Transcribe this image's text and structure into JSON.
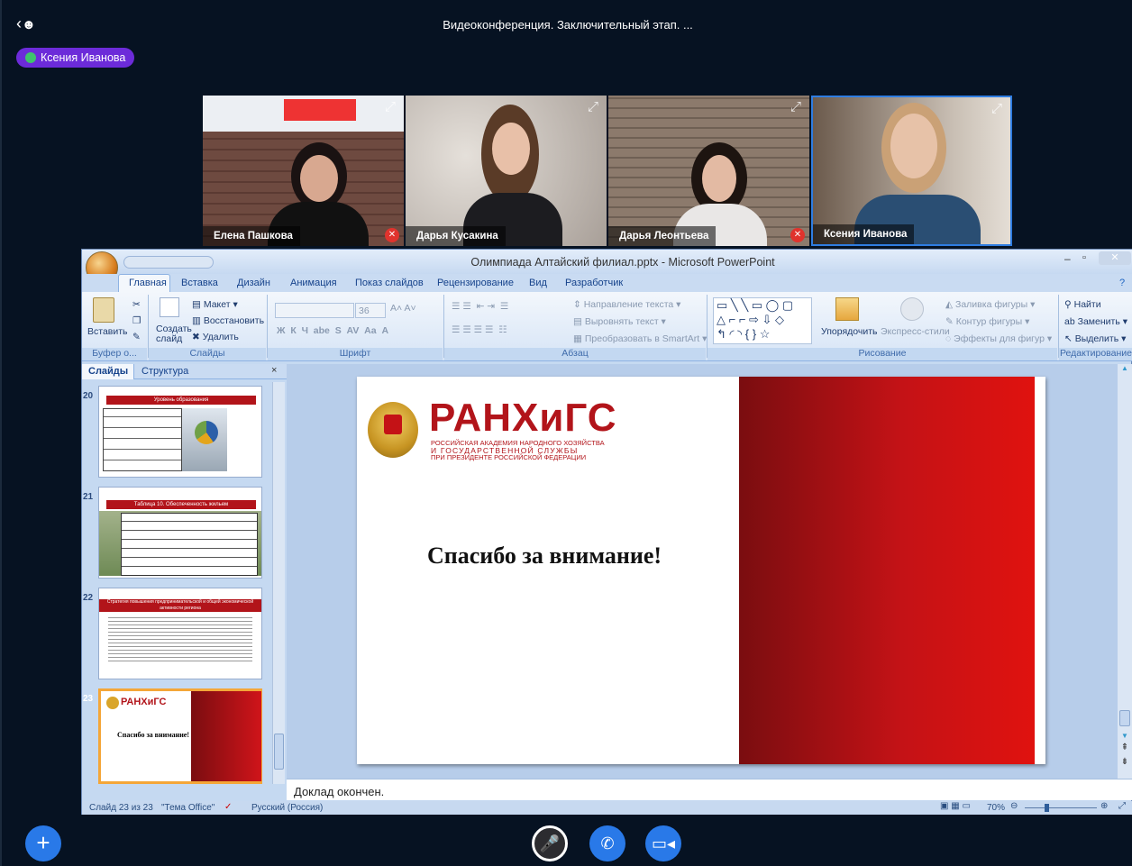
{
  "conference": {
    "title": "Видеоконференция. Заключительный этап. ...",
    "active_speaker": "Ксения Иванова"
  },
  "participants": [
    {
      "name": "Елена Пашкова",
      "muted": true
    },
    {
      "name": "Дарья Кусакина",
      "muted": false
    },
    {
      "name": "Дарья Леонтьева",
      "muted": true
    },
    {
      "name": "Ксения Иванова",
      "muted": false
    }
  ],
  "ppt": {
    "window_title": "Олимпиада Алтайский филиал.pptx - Microsoft PowerPoint",
    "tabs": [
      "Главная",
      "Вставка",
      "Дизайн",
      "Анимация",
      "Показ слайдов",
      "Рецензирование",
      "Вид",
      "Разработчик"
    ],
    "ribbon": {
      "paste": "Вставить",
      "new_slide": "Создать слайд",
      "layout": "Макет",
      "reset": "Восстановить",
      "delete": "Удалить",
      "font_size": "36",
      "text_direction": "Направление текста",
      "align_text": "Выровнять текст",
      "smartart": "Преобразовать в SmartArt",
      "arrange": "Упорядочить",
      "quick_styles": "Экспресс-стили",
      "shape_fill": "Заливка фигуры",
      "shape_outline": "Контур фигуры",
      "shape_effects": "Эффекты для фигур",
      "find": "Найти",
      "replace": "Заменить",
      "select": "Выделить",
      "groups": {
        "clipboard": "Буфер о...",
        "slides": "Слайды",
        "font": "Шрифт",
        "paragraph": "Абзац",
        "drawing": "Рисование",
        "editing": "Редактирование"
      }
    },
    "panel_tabs": [
      "Слайды",
      "Структура"
    ],
    "thumbnails": [
      {
        "num": "20",
        "title": "Уровень образования"
      },
      {
        "num": "21",
        "title": "Таблица 10. Обеспеченность жильем"
      },
      {
        "num": "22",
        "title": "Стратегия повышения предпринимательской и общей экономической активности региона"
      },
      {
        "num": "23",
        "title": "Спасибо за внимание!"
      }
    ],
    "slide": {
      "logo_main": "РАНХиГС",
      "logo_sub1": "РОССИЙСКАЯ АКАДЕМИЯ НАРОДНОГО ХОЗЯЙСТВА",
      "logo_sub2": "И ГОСУДАРСТВЕННОЙ СЛУЖБЫ",
      "logo_sub3": "ПРИ ПРЕЗИДЕНТЕ РОССИЙСКОЙ ФЕДЕРАЦИИ",
      "heading": "Спасибо за внимание!"
    },
    "notes": "Доклад окончен.",
    "status": {
      "slide_counter": "Слайд 23 из 23",
      "theme": "\"Тема Office\"",
      "language": "Русский (Россия)",
      "zoom": "70%"
    },
    "colors": {
      "accent_red": "#c41216",
      "ribbon_blue": "#15428b"
    }
  }
}
